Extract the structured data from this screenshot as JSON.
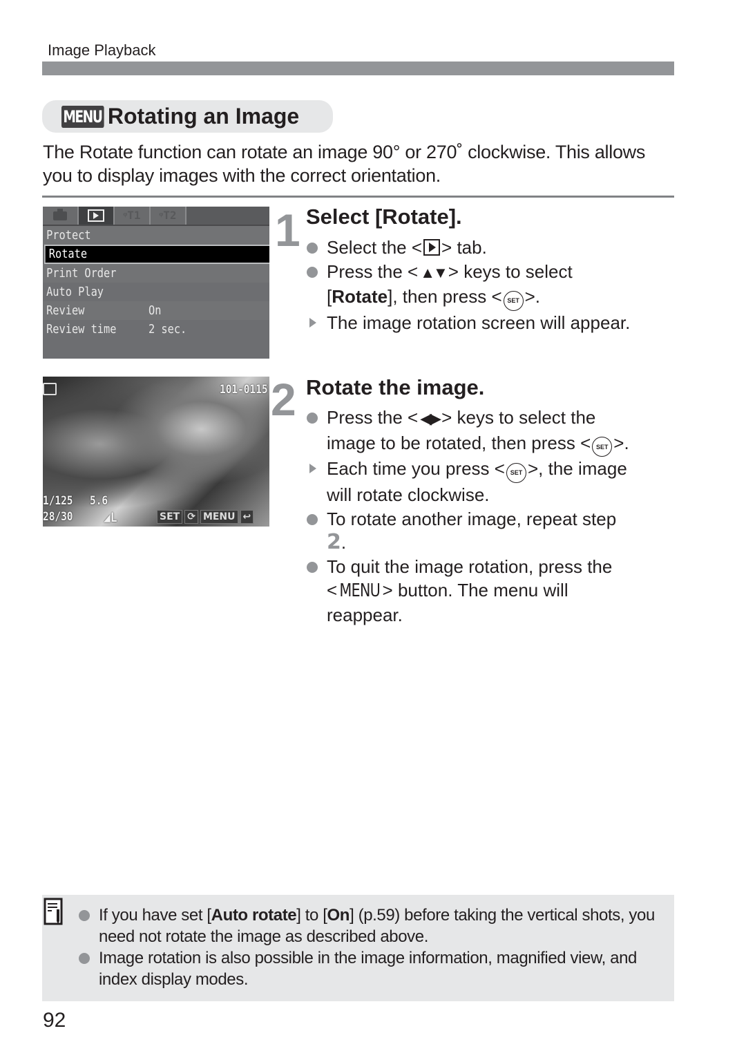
{
  "header": {
    "section": "Image Playback"
  },
  "title": {
    "badge": "MENU",
    "text": "Rotating an Image"
  },
  "intro": "The Rotate function can rotate an image 90° or 270˚ clockwise. This allows you to display images with the correct orientation.",
  "camera_menu": {
    "tabs": [
      {
        "icon": "camera-icon"
      },
      {
        "icon": "playback-icon",
        "active": true
      },
      {
        "label": "ᵠT1"
      },
      {
        "label": "ᵠT2"
      }
    ],
    "items": [
      {
        "label": "Protect",
        "value": ""
      },
      {
        "label": "Rotate",
        "value": "",
        "selected": true
      },
      {
        "label": "Print Order",
        "value": ""
      },
      {
        "label": "Auto Play",
        "value": ""
      },
      {
        "label": "Review",
        "value": "On"
      },
      {
        "label": "Review time",
        "value": "2 sec."
      }
    ]
  },
  "camera_rotate_screen": {
    "file_number": "101-0115",
    "shutter": "1/125",
    "aperture": "5.6",
    "counter": "28/30",
    "quality": "◢L",
    "buttons": [
      "SET",
      "MENU"
    ]
  },
  "steps": [
    {
      "number": "1",
      "title": "Select [Rotate].",
      "lines": {
        "b1_pre": "Select the <",
        "b1_post": "> tab.",
        "b2_pre": "Press the <",
        "b2_keys": "▲▼",
        "b2_post": "> keys to select",
        "b2_l2_open": "[",
        "b2_l2_bold": "Rotate",
        "b2_l2_mid": "], then press <",
        "b2_l2_end": ">.",
        "r1": "The image rotation screen will appear."
      }
    },
    {
      "number": "2",
      "title": "Rotate the image.",
      "lines": {
        "b1_pre": "Press the <",
        "b1_keys": "◀▶",
        "b1_post": "> keys to select the",
        "b1_l2": "image to be rotated, then press <",
        "b1_l2_end": ">.",
        "r1_pre": "Each time you press <",
        "r1_post": ">, the image",
        "r1_l2": "will rotate clockwise.",
        "b2": "To rotate another image, repeat step",
        "b2_ref": "2",
        "b2_end": ".",
        "b3": "To quit the image rotation, press the",
        "b3_pre": "<",
        "b3_menu": "MENU",
        "b3_post": "> button. The menu will",
        "b3_l3": "reappear."
      }
    }
  ],
  "set_icon_label": "SET",
  "note": {
    "items": [
      {
        "pre": "If you have set [",
        "bold1": "Auto rotate",
        "mid": "] to [",
        "bold2": "On",
        "post": "] (p.59) before taking the vertical shots, you need not rotate the image as described above."
      },
      {
        "text": "Image rotation is also possible in the image information, magnified view, and index display modes."
      }
    ]
  },
  "page_number": "92"
}
